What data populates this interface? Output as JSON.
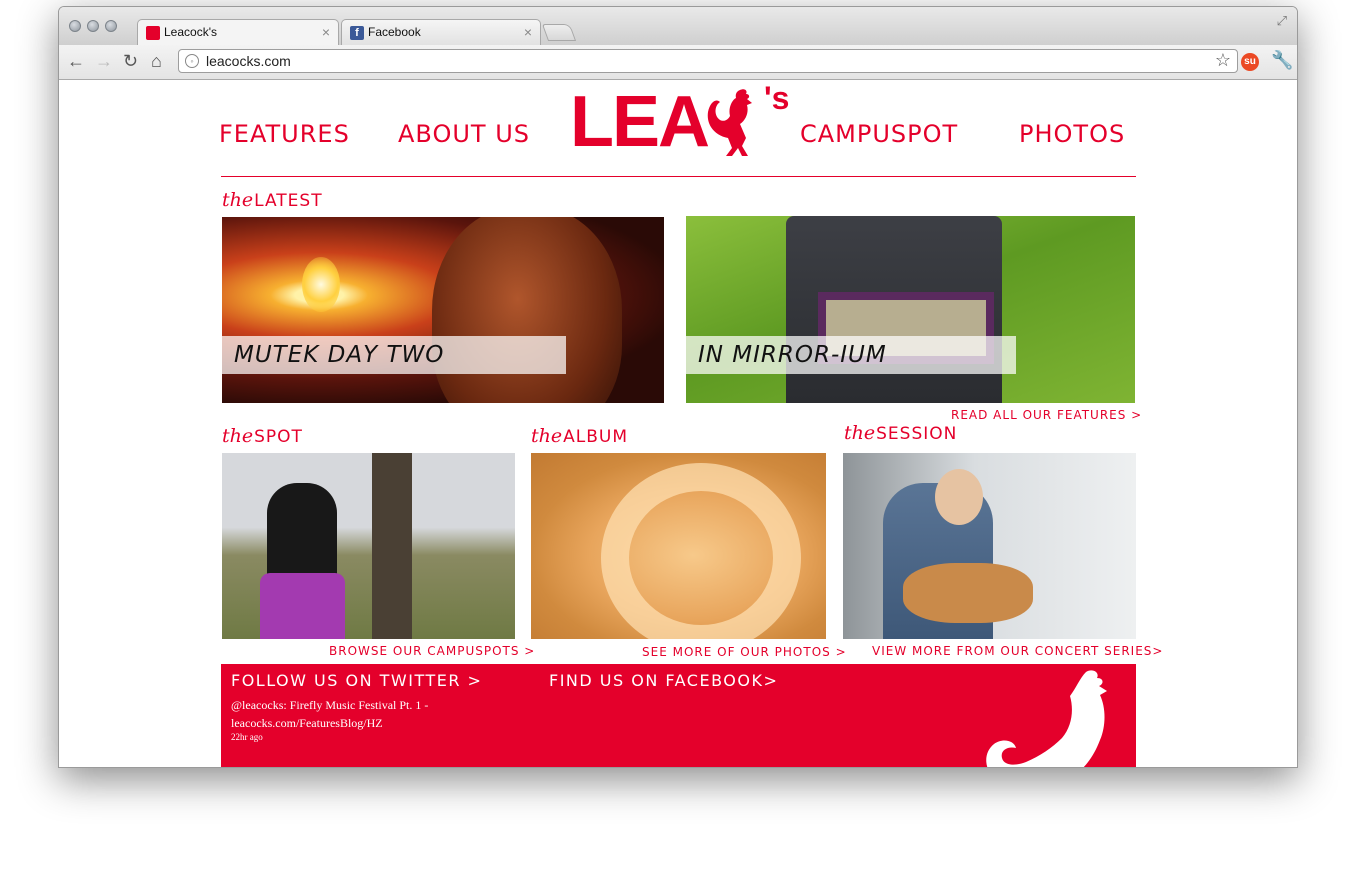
{
  "browser": {
    "tabs": [
      {
        "title": "Leacock's"
      },
      {
        "title": "Facebook"
      }
    ],
    "url": "leacocks.com"
  },
  "site": {
    "nav": {
      "features": "FEATURES",
      "about": "ABOUT US",
      "campuspot": "CAMPUSPOT",
      "photos": "PHOTOS"
    },
    "logo": {
      "text": "LEA",
      "suffix": "'s",
      "accent_color": "#e4002b"
    },
    "latest": {
      "prefix": "the",
      "label": "LATEST",
      "items": [
        {
          "caption": "MUTEK DAY TWO"
        },
        {
          "caption": "IN MIRROR-IUM"
        }
      ],
      "more_link": "READ ALL OUR FEATURES >"
    },
    "spot": {
      "prefix": "the",
      "label": "SPOT",
      "more_link": "BROWSE OUR CAMPUSPOTS >"
    },
    "album": {
      "prefix": "the",
      "label": "ALBUM",
      "more_link": "SEE MORE OF OUR PHOTOS >"
    },
    "session": {
      "prefix": "the",
      "label": "SESSION",
      "more_link": "VIEW MORE FROM OUR CONCERT SERIES>"
    },
    "footer": {
      "twitter_heading": "FOLLOW US ON TWITTER >",
      "facebook_heading": "FIND US ON FACEBOOK>",
      "tweet_text": "@leacocks: Firefly Music Festival Pt. 1 - leacocks.com/FeaturesBlog/HZ",
      "tweet_time": "22hr ago"
    }
  },
  "icons": [
    "back-icon",
    "forward-icon",
    "reload-icon",
    "home-icon",
    "globe-icon",
    "star-icon",
    "stumbleupon-icon",
    "wrench-icon",
    "rooster-icon"
  ]
}
